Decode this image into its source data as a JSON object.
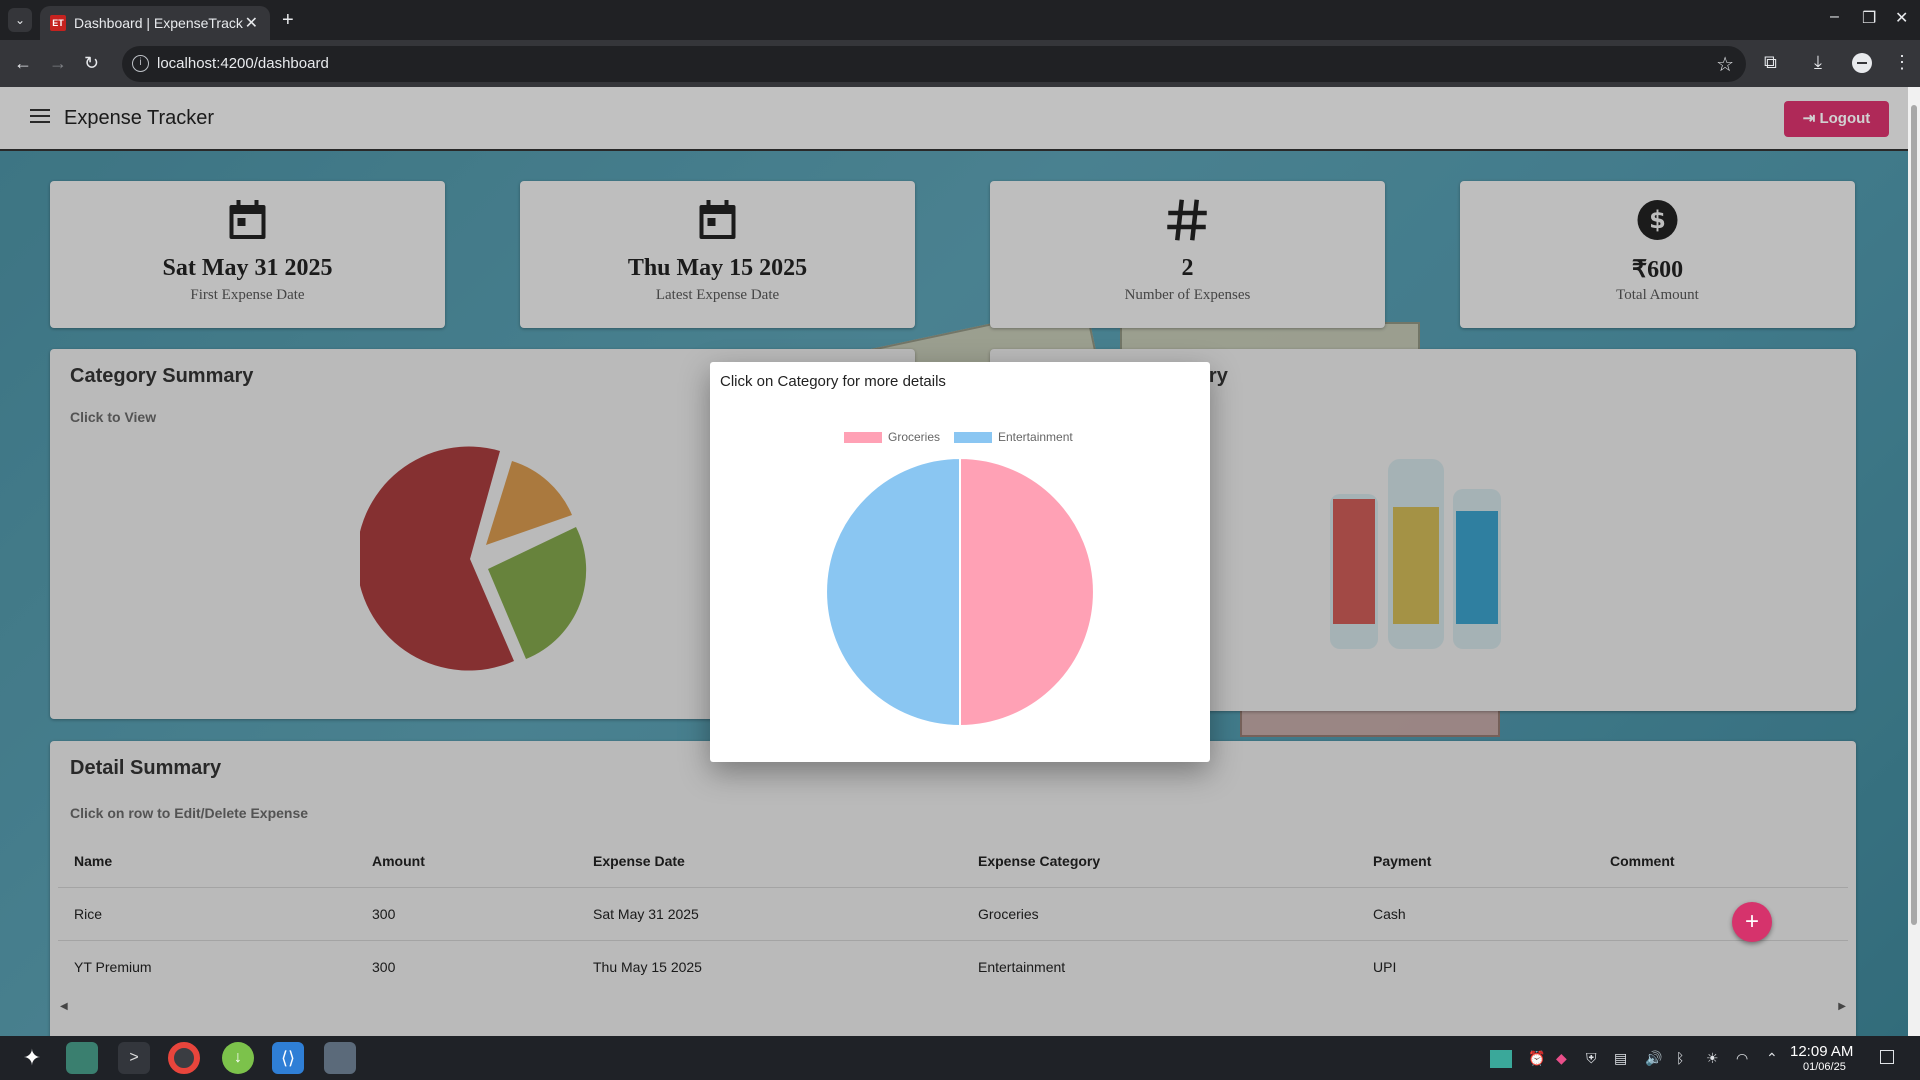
{
  "browser": {
    "tab_title": "Dashboard | ExpenseTrack",
    "favicon_text": "ET",
    "url": "localhost:4200/dashboard"
  },
  "header": {
    "title": "Expense Tracker",
    "logout_label": "Logout"
  },
  "stats": [
    {
      "icon": "calendar-icon",
      "value": "Sat May 31 2025",
      "label": "First Expense Date"
    },
    {
      "icon": "calendar-icon",
      "value": "Thu May 15 2025",
      "label": "Latest Expense Date"
    },
    {
      "icon": "hash-icon",
      "value": "2",
      "label": "Number of Expenses"
    },
    {
      "icon": "dollar-circle-icon",
      "value": "₹600",
      "label": "Total Amount"
    }
  ],
  "category_summary": {
    "title": "Category Summary",
    "subtitle": "Click to View"
  },
  "payment_summary": {
    "title_visible": "mary"
  },
  "detail_summary": {
    "title": "Detail Summary",
    "subtitle": "Click on row to Edit/Delete Expense",
    "columns": [
      "Name",
      "Amount",
      "Expense Date",
      "Expense Category",
      "Payment",
      "Comment"
    ],
    "rows": [
      [
        "Rice",
        "300",
        "Sat May 31 2025",
        "Groceries",
        "Cash",
        ""
      ],
      [
        "YT Premium",
        "300",
        "Thu May 15 2025",
        "Entertainment",
        "UPI",
        ""
      ]
    ]
  },
  "dialog": {
    "title": "Click on Category for more details"
  },
  "chart_data": {
    "type": "pie",
    "title": "",
    "categories": [
      "Groceries",
      "Entertainment"
    ],
    "values": [
      300,
      300
    ],
    "colors": [
      "#ffa1b5",
      "#8ac6f2"
    ],
    "legend": "top"
  },
  "taskbar": {
    "time": "12:09 AM",
    "date": "01/06/25"
  },
  "colors": {
    "accent": "#d6336c",
    "pie_groceries": "#ffa1b5",
    "pie_entertainment": "#8ac6f2"
  }
}
